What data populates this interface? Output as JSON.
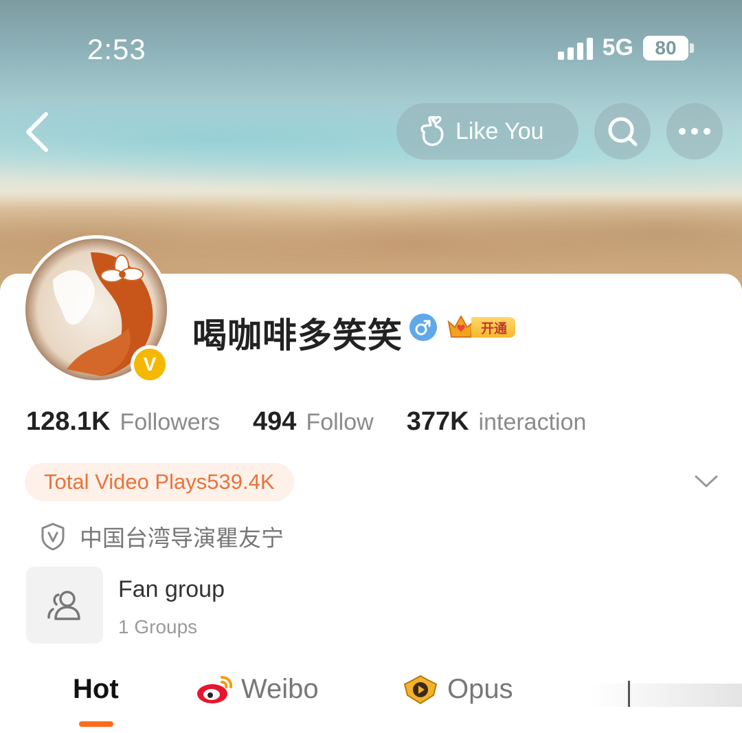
{
  "status_bar": {
    "time": "2:53",
    "network": "5G",
    "battery": "80"
  },
  "header": {
    "like_label": "Like You"
  },
  "profile": {
    "name": "喝咖啡多笑笑",
    "vip_label": "开通",
    "verify_mark": "V",
    "stats": [
      {
        "value": "128.1K",
        "label": "Followers"
      },
      {
        "value": "494",
        "label": "Follow"
      },
      {
        "value": "377K",
        "label": "interaction"
      }
    ],
    "video_plays": "Total Video Plays539.4K",
    "certification": "中国台湾导演瞿友宁",
    "fan_group": {
      "title": "Fan group",
      "count": "1 Groups"
    }
  },
  "tabs": [
    {
      "label": "Hot",
      "active": true
    },
    {
      "label": "Weibo",
      "active": false
    },
    {
      "label": "Opus",
      "active": false
    }
  ],
  "colors": {
    "accent": "#ff6a1a",
    "chip_text": "#e8733a",
    "gender": "#5fa9ea",
    "verify": "#f5b800"
  },
  "icons": [
    "back-arrow-icon",
    "hand-heart-icon",
    "search-icon",
    "more-icon",
    "gender-male-icon",
    "crown-icon",
    "shield-v-icon",
    "group-icon",
    "weibo-logo-icon",
    "opus-icon",
    "chevron-down-icon"
  ]
}
